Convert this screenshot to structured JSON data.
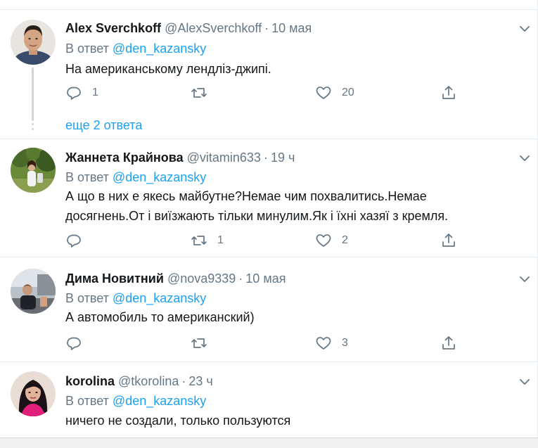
{
  "replies_label": "В ответ",
  "tweets": [
    {
      "name": "Alex Sverchkoff",
      "handle": "@AlexSverchkoff",
      "time": "10 мая",
      "mention": "@den_kazansky",
      "text": "На американському лендліз-джипі.",
      "reply_count": "1",
      "retweet_count": "",
      "like_count": "20"
    },
    {
      "name": "Жаннета Крайнова",
      "handle": "@vitamin633",
      "time": "19 ч",
      "mention": "@den_kazansky",
      "text": "А що в них е якесь майбутне?Немае чим похвалитись.Немае досягнень.От і виїзжають тільки минулим.Як і їхні  хазяї з кремля.",
      "reply_count": "",
      "retweet_count": "1",
      "like_count": "2"
    },
    {
      "name": "Дима Новитний",
      "handle": "@nova9339",
      "time": "10 мая",
      "mention": "@den_kazansky",
      "text": "А автомобиль то американский)",
      "reply_count": "",
      "retweet_count": "",
      "like_count": "3"
    },
    {
      "name": "korolina",
      "handle": "@tkorolina",
      "time": "23 ч",
      "mention": "@den_kazansky",
      "text": "ничего не создали, только пользуются"
    }
  ],
  "more_replies": "еще 2 ответа",
  "icons": {
    "reply": "reply-icon",
    "retweet": "retweet-icon",
    "like": "heart-icon",
    "share": "share-icon",
    "menu": "chevron-down-icon"
  },
  "colors": {
    "link": "#1da1f2",
    "muted": "#657786",
    "border": "#e6ecf0"
  }
}
